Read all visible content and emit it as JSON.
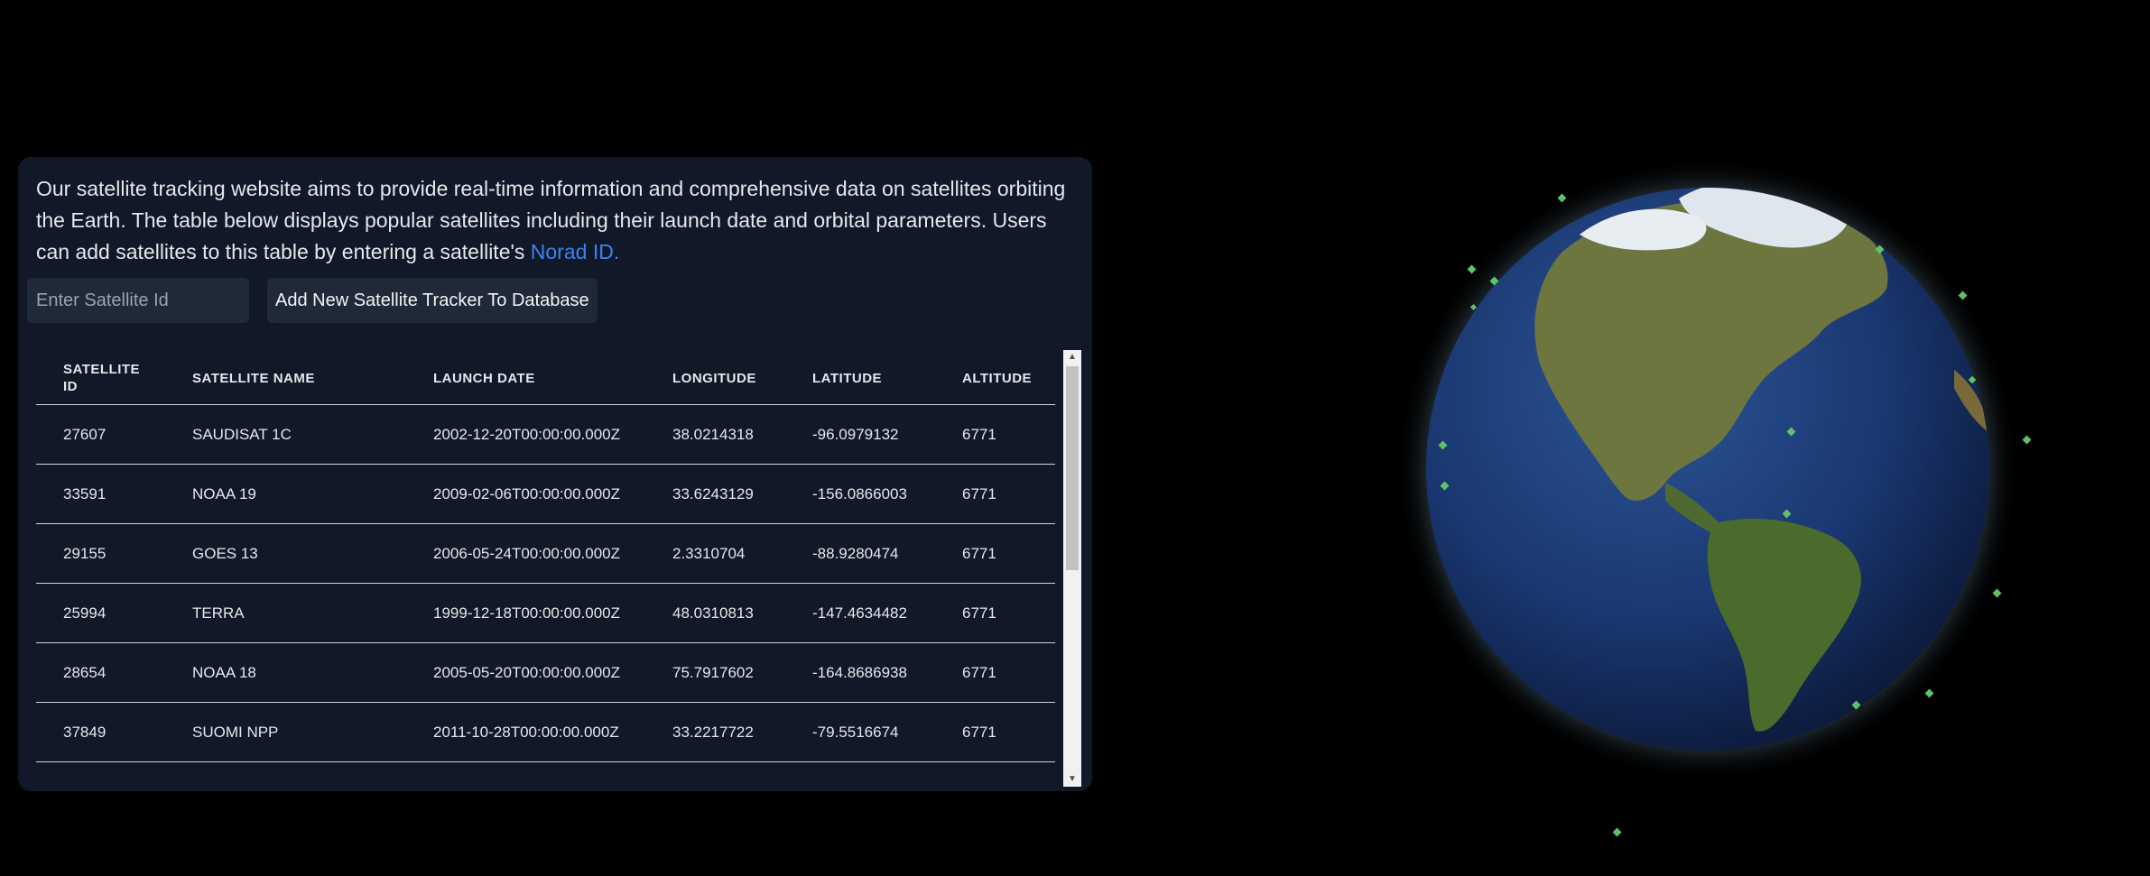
{
  "intro": {
    "text": "Our satellite tracking website aims to provide real-time information and comprehensive data on satellites orbiting the Earth. The table below displays popular satellites including their launch date and orbital parameters. Users can add satellites to this table by entering a satellite's ",
    "link_text": "Norad ID."
  },
  "form": {
    "input_placeholder": "Enter Satellite Id",
    "input_value": "",
    "add_button_label": "Add New Satellite Tracker To Database"
  },
  "table": {
    "headers": {
      "id": "SATELLITE ID",
      "name": "SATELLITE NAME",
      "launch": "LAUNCH DATE",
      "longitude": "LONGITUDE",
      "latitude": "LATITUDE",
      "altitude": "ALTITUDE"
    },
    "rows": [
      {
        "id": "27607",
        "name": "SAUDISAT 1C",
        "launch": "2002-12-20T00:00:00.000Z",
        "longitude": "38.0214318",
        "latitude": "-96.0979132",
        "altitude": "6771"
      },
      {
        "id": "33591",
        "name": "NOAA 19",
        "launch": "2009-02-06T00:00:00.000Z",
        "longitude": "33.6243129",
        "latitude": "-156.0866003",
        "altitude": "6771"
      },
      {
        "id": "29155",
        "name": "GOES 13",
        "launch": "2006-05-24T00:00:00.000Z",
        "longitude": "2.3310704",
        "latitude": "-88.9280474",
        "altitude": "6771"
      },
      {
        "id": "25994",
        "name": "TERRA",
        "launch": "1999-12-18T00:00:00.000Z",
        "longitude": "48.0310813",
        "latitude": "-147.4634482",
        "altitude": "6771"
      },
      {
        "id": "28654",
        "name": "NOAA 18",
        "launch": "2005-05-20T00:00:00.000Z",
        "longitude": "75.7917602",
        "latitude": "-164.8686938",
        "altitude": "6771"
      },
      {
        "id": "37849",
        "name": "SUOMI NPP",
        "launch": "2011-10-28T00:00:00.000Z",
        "longitude": "33.2217722",
        "latitude": "-79.5516674",
        "altitude": "6771"
      }
    ]
  },
  "colors": {
    "page_background": "#000000",
    "panel_background": "#111827",
    "link": "#3b82f6",
    "satellite_marker": "#5fc26b",
    "ocean": "#1e3f7a",
    "land": "#6b7a3e"
  },
  "icons": {
    "scroll_up": "scroll-up-arrow-icon",
    "scroll_down": "scroll-down-arrow-icon",
    "satellite": "satellite-marker-icon"
  }
}
